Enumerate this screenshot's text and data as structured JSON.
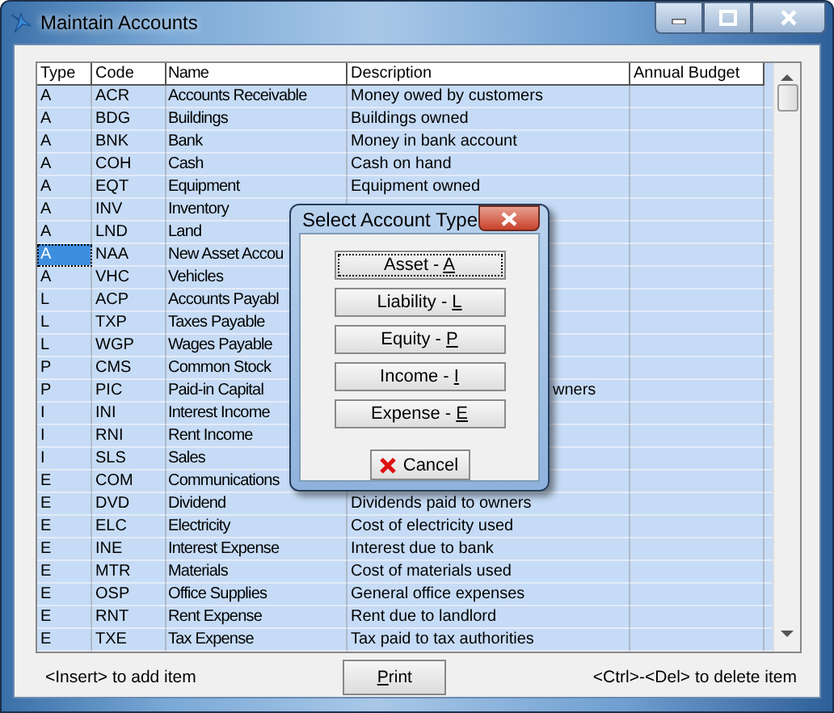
{
  "window": {
    "title": "Maintain Accounts"
  },
  "table": {
    "columns": [
      "Type",
      "Code",
      "Name",
      "Description",
      "Annual Budget"
    ],
    "rows": [
      {
        "type": "A",
        "code": "ACR",
        "name": "Accounts Receivable",
        "description": "Money owed by customers",
        "selected": false
      },
      {
        "type": "A",
        "code": "BDG",
        "name": "Buildings",
        "description": "Buildings owned",
        "selected": false
      },
      {
        "type": "A",
        "code": "BNK",
        "name": "Bank",
        "description": "Money in bank account",
        "selected": false
      },
      {
        "type": "A",
        "code": "COH",
        "name": "Cash",
        "description": "Cash on hand",
        "selected": false
      },
      {
        "type": "A",
        "code": "EQT",
        "name": "Equipment",
        "description": "Equipment owned",
        "selected": false
      },
      {
        "type": "A",
        "code": "INV",
        "name": "Inventory",
        "selected": false
      },
      {
        "type": "A",
        "code": "LND",
        "name": "Land",
        "selected": false
      },
      {
        "type": "A",
        "code": "NAA",
        "name": "New Asset Accou",
        "selected": true
      },
      {
        "type": "A",
        "code": "VHC",
        "name": "Vehicles",
        "selected": false
      },
      {
        "type": "L",
        "code": "ACP",
        "name": "Accounts Payabl",
        "selected": false
      },
      {
        "type": "L",
        "code": "TXP",
        "name": "Taxes Payable",
        "selected": false
      },
      {
        "type": "L",
        "code": "WGP",
        "name": "Wages Payable",
        "selected": false
      },
      {
        "type": "P",
        "code": "CMS",
        "name": "Common Stock",
        "selected": false
      },
      {
        "type": "P",
        "code": "PIC",
        "name": "Paid-in Capital",
        "description": "wners",
        "description_start_hidden": true,
        "selected": false
      },
      {
        "type": "I",
        "code": "INI",
        "name": "Interest Income",
        "selected": false
      },
      {
        "type": "I",
        "code": "RNI",
        "name": "Rent Income",
        "selected": false
      },
      {
        "type": "I",
        "code": "SLS",
        "name": "Sales",
        "selected": false
      },
      {
        "type": "E",
        "code": "COM",
        "name": "Communications",
        "selected": false
      },
      {
        "type": "E",
        "code": "DVD",
        "name": "Dividend",
        "description": "Dividends paid to owners",
        "selected": false
      },
      {
        "type": "E",
        "code": "ELC",
        "name": "Electricity",
        "description": "Cost of electricity used",
        "selected": false
      },
      {
        "type": "E",
        "code": "INE",
        "name": "Interest Expense",
        "description": "Interest due to bank",
        "selected": false
      },
      {
        "type": "E",
        "code": "MTR",
        "name": "Materials",
        "description": "Cost of materials used",
        "selected": false
      },
      {
        "type": "E",
        "code": "OSP",
        "name": "Office Supplies",
        "description": "General office expenses",
        "selected": false
      },
      {
        "type": "E",
        "code": "RNT",
        "name": "Rent Expense",
        "description": "Rent due to landlord",
        "selected": false
      },
      {
        "type": "E",
        "code": "TXE",
        "name": "Tax Expense",
        "description": "Tax paid to tax authorities",
        "selected": false
      }
    ]
  },
  "footer": {
    "left_hint": "<Insert> to add item",
    "print_button": [
      {
        "text": "P",
        "underline": true
      },
      {
        "text": "rint",
        "underline": false
      }
    ],
    "right_hint": "<Ctrl>-<Del> to delete item"
  },
  "dialog": {
    "title": "Select Account Type",
    "options": [
      {
        "parts": [
          {
            "text": "Asset - ",
            "underline": false
          },
          {
            "text": "A",
            "underline": true
          }
        ],
        "focused": true
      },
      {
        "parts": [
          {
            "text": "Liability - ",
            "underline": false
          },
          {
            "text": "L",
            "underline": true
          }
        ],
        "focused": false
      },
      {
        "parts": [
          {
            "text": "Equity - ",
            "underline": false
          },
          {
            "text": "P",
            "underline": true
          }
        ],
        "focused": false
      },
      {
        "parts": [
          {
            "text": "Income - ",
            "underline": false
          },
          {
            "text": "I",
            "underline": true
          }
        ],
        "focused": false
      },
      {
        "parts": [
          {
            "text": "Expense - ",
            "underline": false
          },
          {
            "text": "E",
            "underline": true
          }
        ],
        "focused": false
      }
    ],
    "cancel": "Cancel"
  }
}
